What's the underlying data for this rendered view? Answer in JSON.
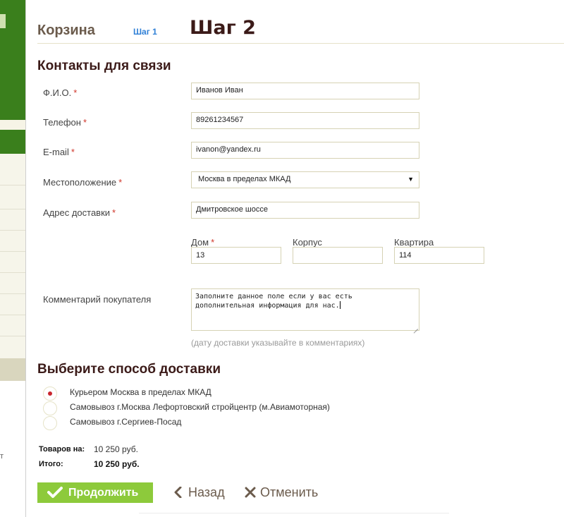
{
  "background": {
    "partial_text": "т"
  },
  "header": {
    "cart_title": "Корзина",
    "step1_link": "Шаг 1",
    "step_title": "Шаг 2"
  },
  "contacts": {
    "title": "Контакты для связи",
    "required_mark": "*",
    "fio": {
      "label": "Ф.И.О.",
      "value": "Иванов Иван"
    },
    "phone": {
      "label": "Телефон",
      "value": "89261234567"
    },
    "email": {
      "label": "E-mail",
      "value": "ivanon@yandex.ru"
    },
    "location": {
      "label": "Местоположение",
      "value": "Москва в пределах МКАД"
    },
    "address": {
      "label": "Адрес доставки",
      "value": "Дмитровское шоссе"
    },
    "house": {
      "label": "Дом",
      "value": "13"
    },
    "building": {
      "label": "Корпус",
      "value": ""
    },
    "apartment": {
      "label": "Квартира",
      "value": "114"
    },
    "comment": {
      "label": "Комментарий покупателя",
      "value": "Заполните данное поле если у вас есть дополнительная информация для нас.",
      "hint": "(дату доставки указывайте в комментариях)"
    }
  },
  "delivery": {
    "title": "Выберите способ доставки",
    "options": [
      {
        "label": "Курьером Москва в пределах МКАД",
        "selected": true
      },
      {
        "label": "Самовывоз г.Москва Лефортовский стройцентр (м.Авиамоторная)",
        "selected": false
      },
      {
        "label": "Самовывоз г.Сергиев-Посад",
        "selected": false
      }
    ]
  },
  "summary": {
    "goods_label": "Товаров на:",
    "goods_value": "10 250 руб.",
    "total_label": "Итого:",
    "total_value": "10 250 руб."
  },
  "actions": {
    "continue_label": "Продолжить",
    "back_label": "Назад",
    "cancel_label": "Отменить"
  },
  "colors": {
    "accent_green": "#8dca3b",
    "heading_dark": "#3b1a18",
    "link_blue": "#2e7fd6",
    "required_red": "#d0372b"
  }
}
